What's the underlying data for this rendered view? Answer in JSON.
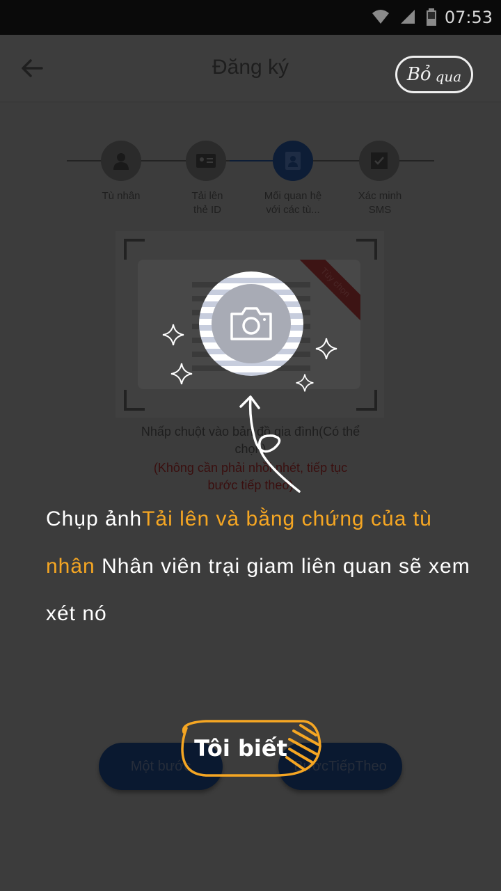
{
  "status_bar": {
    "time": "07:53"
  },
  "header": {
    "title": "Đăng ký",
    "skip_label_1": "Bỏ",
    "skip_label_2": "qua"
  },
  "steps": [
    {
      "label": "Tù nhân",
      "icon": "person-icon",
      "active": false
    },
    {
      "label": "Tải lên\nthẻ ID",
      "icon": "id-card-icon",
      "active": false
    },
    {
      "label": "Mối quan hệ\nvới các tù...",
      "icon": "contact-icon",
      "active": true
    },
    {
      "label": "Xác minh\nSMS",
      "icon": "checkbox-icon",
      "active": false
    }
  ],
  "upload": {
    "ribbon": "Tùy chọn",
    "hint": "Nhấp chuột vào bản đồ gia đình(Có thể chọn)",
    "note": "(Không cần phải nhồi nhét, tiếp tục bước tiếp theo)"
  },
  "tooltip": {
    "part1": "Chụp ảnh",
    "highlight": "Tải lên và bằng chứng của tù nhân",
    "part2": " Nhân viên trại giam liên quan sẽ xem xét nó"
  },
  "buttons": {
    "prev": "Một bước",
    "next": "BướcTiếpTheo",
    "got_it": "Tôi biết"
  },
  "colors": {
    "highlight": "#f5a623",
    "overlay_bg": "#3c3c3c",
    "primary_dark": "#0a1930"
  }
}
